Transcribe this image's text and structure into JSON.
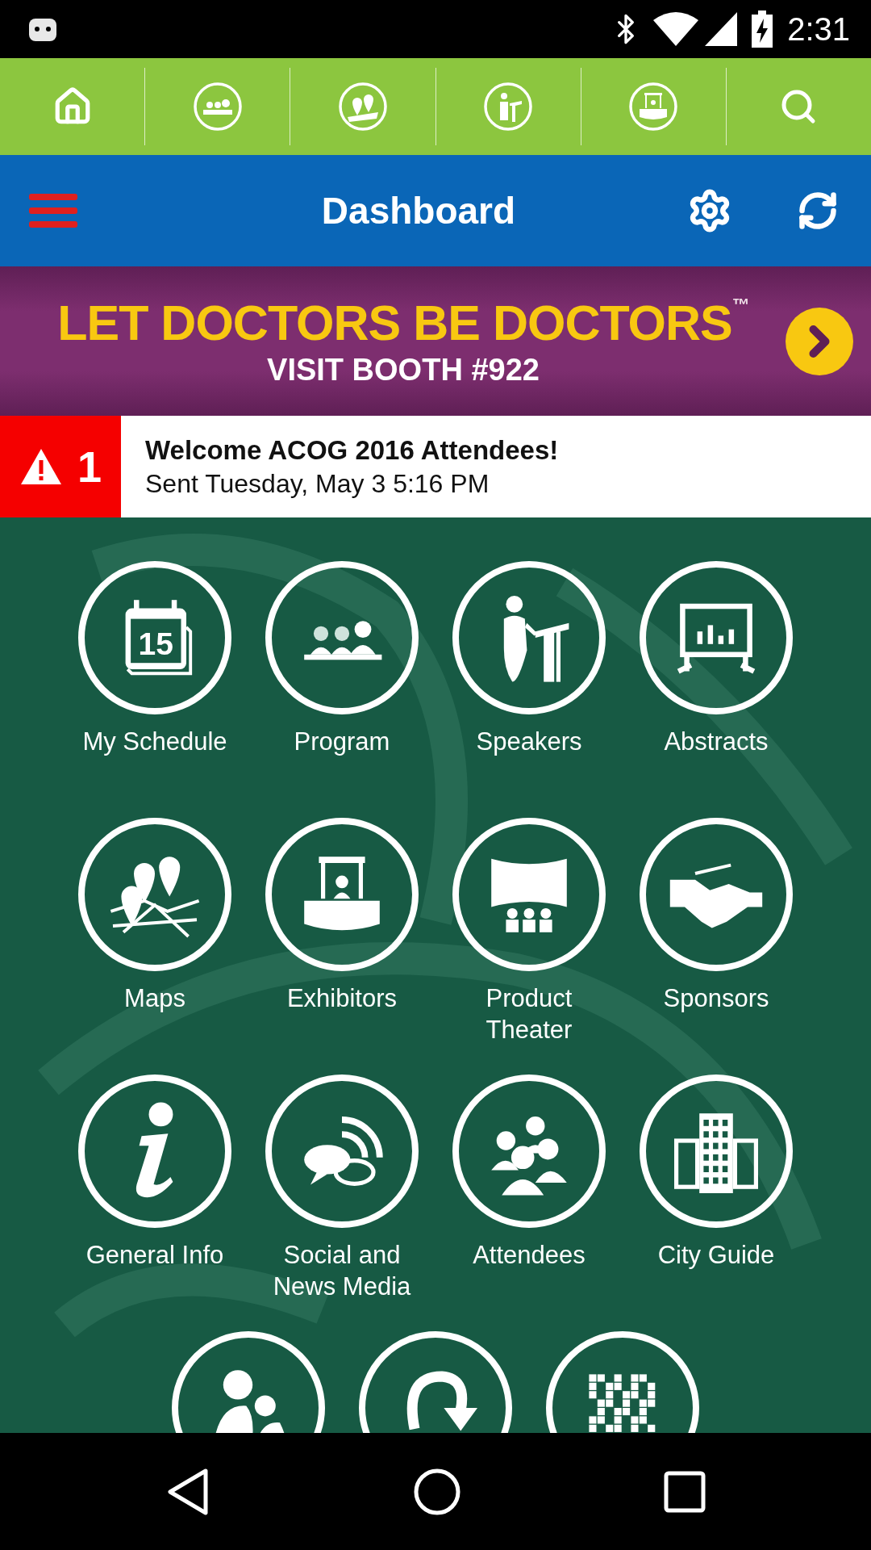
{
  "status_bar": {
    "time": "2:31"
  },
  "toolbar": {
    "items": [
      {
        "kind": "home"
      },
      {
        "kind": "audience"
      },
      {
        "kind": "map"
      },
      {
        "kind": "speaker"
      },
      {
        "kind": "booth"
      },
      {
        "kind": "search"
      }
    ]
  },
  "header": {
    "title": "Dashboard"
  },
  "banner": {
    "headline": "LET DOCTORS BE DOCTORS",
    "trademark": "™",
    "subline": "VISIT BOOTH #922"
  },
  "alert": {
    "count": "1",
    "title": "Welcome ACOG 2016 Attendees!",
    "sent": "Sent Tuesday, May 3 5:16 PM"
  },
  "tiles": [
    {
      "kind": "calendar",
      "label": "My Schedule",
      "icon_text": "15"
    },
    {
      "kind": "audience",
      "label": "Program"
    },
    {
      "kind": "speaker",
      "label": "Speakers"
    },
    {
      "kind": "board",
      "label": "Abstracts"
    },
    {
      "kind": "map",
      "label": "Maps"
    },
    {
      "kind": "booth",
      "label": "Exhibitors"
    },
    {
      "kind": "theater",
      "label": "Product Theater"
    },
    {
      "kind": "handshake",
      "label": "Sponsors"
    },
    {
      "kind": "info",
      "label": "General Info"
    },
    {
      "kind": "chat",
      "label": "Social and News Media"
    },
    {
      "kind": "people",
      "label": "Attendees"
    },
    {
      "kind": "building",
      "label": "City Guide"
    },
    {
      "kind": "family"
    },
    {
      "kind": "arrow"
    },
    {
      "kind": "qr"
    }
  ]
}
